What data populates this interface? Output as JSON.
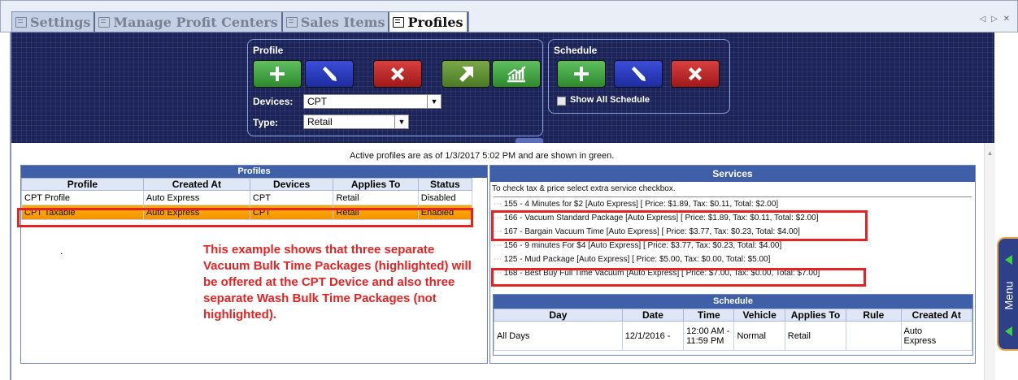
{
  "tabs": [
    {
      "label": "Settings"
    },
    {
      "label": "Manage Profit Centers"
    },
    {
      "label": "Sales Items"
    },
    {
      "label": "Profiles"
    }
  ],
  "window_controls": "◁ ▷ ✕",
  "toolbar": {
    "profile_group": "Profile",
    "schedule_group": "Schedule",
    "devices_label": "Devices:",
    "devices_value": "CPT",
    "type_label": "Type:",
    "type_value": "Retail",
    "show_all_schedule": "Show All Schedule"
  },
  "notice": "Active profiles are as of 1/3/2017 5:02 PM and are shown in green.",
  "profiles": {
    "title": "Profiles",
    "columns": [
      "Profile",
      "Created At",
      "Devices",
      "Applies To",
      "Status"
    ],
    "rows": [
      [
        "CPT Profile",
        "Auto Express",
        "CPT",
        "Retail",
        "Disabled"
      ],
      [
        "CPT Taxable",
        "Auto Express",
        "CPT",
        "Retail",
        "Enabled"
      ]
    ]
  },
  "dot_note": ".",
  "annotation": "This example shows that three separate Vacuum Bulk Time Packages (highlighted) will be offered at the CPT Device and also three separate Wash Bulk Time Packages (not highlighted).",
  "services": {
    "title": "Services",
    "hint": "To check tax & price select extra service checkbox.",
    "items": [
      "155 - 4 Minutes for $2 [Auto Express]  [ Price: $1.89, Tax: $0.11, Total: $2.00]",
      "166 - Vacuum Standard Package [Auto Express]  [ Price: $1.89, Tax: $0.11, Total: $2.00]",
      "167 - Bargain Vacuum Time [Auto Express]  [ Price: $3.77, Tax: $0.23, Total: $4.00]",
      "156 - 9 minutes For $4 [Auto Express]  [ Price: $3.77, Tax: $0.23, Total: $4.00]",
      "125 - Mud Package [Auto Express]  [ Price: $5.00, Tax: $0.00, Total: $5.00]",
      "168 - Best Buy Full Time Vacuum [Auto Express]  [ Price: $7.00, Tax: $0.00, Total: $7.00]"
    ]
  },
  "schedule": {
    "title": "Schedule",
    "columns": [
      "Day",
      "Date",
      "Time",
      "Vehicle",
      "Applies To",
      "Rule",
      "Created At"
    ],
    "row": {
      "day": "All Days",
      "date": "12/1/2016 -",
      "time1": "12:00 AM -",
      "time2": "11:59 PM",
      "vehicle": "Normal",
      "applies_to": "Retail",
      "rule": "",
      "created1": "Auto",
      "created2": "Express"
    }
  },
  "menu_label": "Menu",
  "colors": {
    "highlight": "#e52323",
    "selected_row": "#f5a000",
    "toolbar_bg": "#1c2356",
    "header_blue": "#3f5fa8"
  }
}
